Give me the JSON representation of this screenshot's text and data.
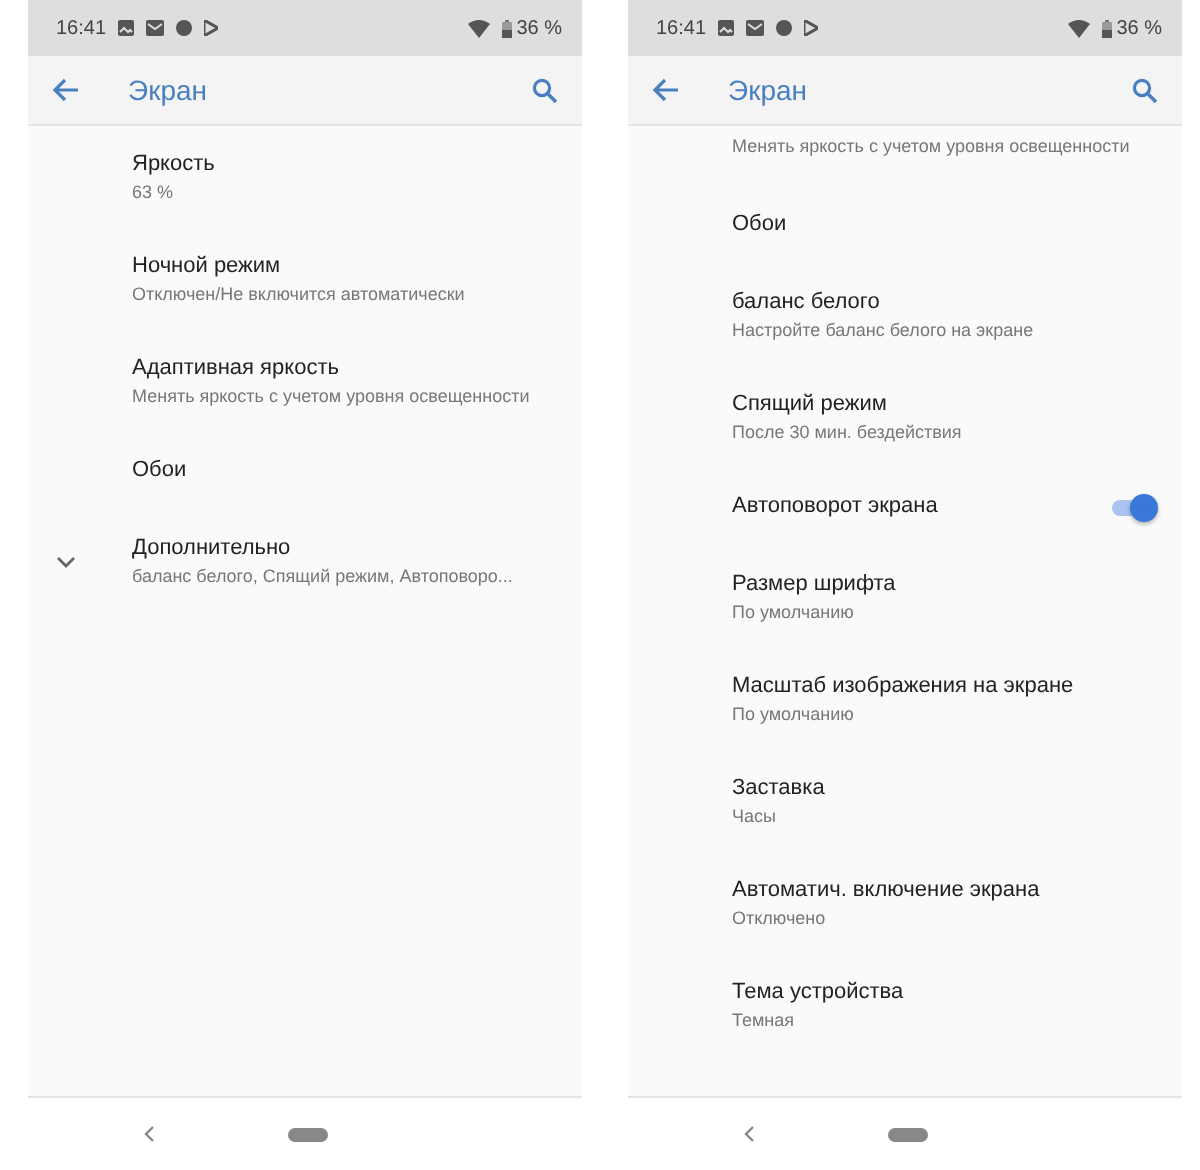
{
  "screens": [
    {
      "status_bar": {
        "time": "16:41",
        "battery": "36 %"
      },
      "app_bar": {
        "title": "Экран"
      },
      "items": [
        {
          "kind": "plain",
          "title": "Яркость",
          "summary": "63 %"
        },
        {
          "kind": "plain",
          "title": "Ночной режим",
          "summary": "Отключен/Не включится автоматически"
        },
        {
          "kind": "plain",
          "title": "Адаптивная яркость",
          "summary": "Менять яркость с учетом уровня освещенности"
        },
        {
          "kind": "plain",
          "title": "Обои"
        },
        {
          "kind": "advanced",
          "title": "Дополнительно",
          "summary": "баланс белого, Спящий режим, Автоповоро..."
        }
      ]
    },
    {
      "status_bar": {
        "time": "16:41",
        "battery": "36 %"
      },
      "app_bar": {
        "title": "Экран"
      },
      "items": [
        {
          "kind": "cut",
          "summary": "Менять яркость с учетом уровня освещенности"
        },
        {
          "kind": "plain",
          "title": "Обои"
        },
        {
          "kind": "plain",
          "title": "баланс белого",
          "summary": "Настройте баланс белого на экране"
        },
        {
          "kind": "plain",
          "title": "Спящий режим",
          "summary": "После 30 мин. бездействия"
        },
        {
          "kind": "toggle",
          "title": "Автоповорот экрана",
          "on": true
        },
        {
          "kind": "plain",
          "title": "Размер шрифта",
          "summary": "По умолчанию"
        },
        {
          "kind": "plain",
          "title": "Масштаб изображения на экране",
          "summary": "По умолчанию"
        },
        {
          "kind": "plain",
          "title": "Заставка",
          "summary": "Часы"
        },
        {
          "kind": "plain",
          "title": "Автоматич. включение экрана",
          "summary": "Отключено"
        },
        {
          "kind": "plain",
          "title": "Тема устройства",
          "summary": "Темная"
        }
      ]
    }
  ]
}
